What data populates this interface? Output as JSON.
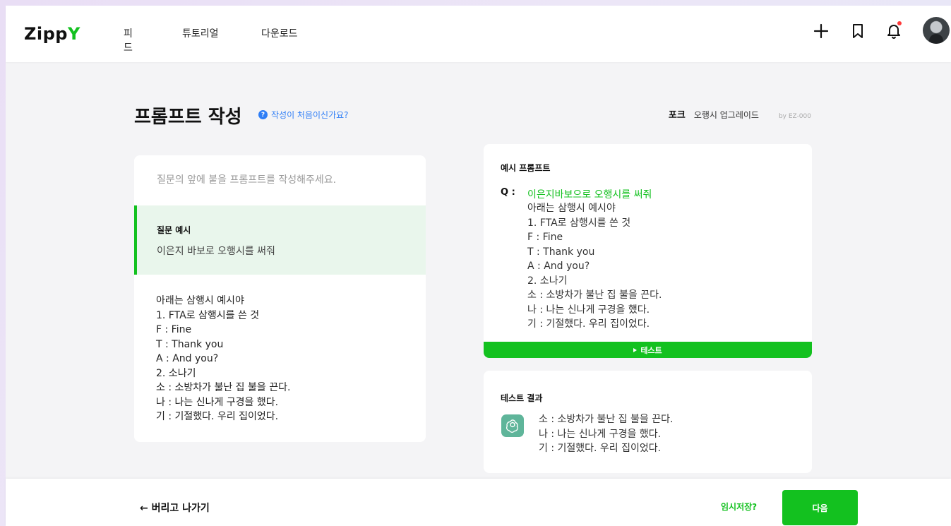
{
  "header": {
    "logo_main": "Zipp",
    "logo_accent": "Y",
    "nav": [
      "피드",
      "튜토리얼",
      "다운로드"
    ]
  },
  "title": {
    "text": "프롬프트 작성",
    "help_icon": "?",
    "help_text": "작성이 처음이신가요?",
    "fork": "포크",
    "prompt_name": "오행시 업그레이드",
    "author": "by EZ-000"
  },
  "editor": {
    "placeholder": "질문의 앞에 붙을 프롬프트를 작성해주세요.",
    "example_label": "질문 예시",
    "example_text": "이은지 바보로 오행시를 써줘",
    "body_lines": [
      "아래는 삼행시 예시야",
      "1. FTA로 삼행시를 쓴 것",
      "F : Fine",
      "T : Thank you",
      "A : And you?",
      "2. 소나기",
      "소 : 소방차가 불난 집 불을 끈다.",
      "나 : 나는 신나게 구경을 했다.",
      "기 : 기절했다. 우리 집이었다."
    ]
  },
  "example_prompt": {
    "title": "예시 프롬프트",
    "q_label": "Q :",
    "question": "이은지바보으로 오행시를 써줘",
    "body_lines": [
      "아래는 삼행시 예시야",
      "1. FTA로 삼행시를 쓴 것",
      "F : Fine",
      "T : Thank you",
      "A : And you?",
      "2. 소나기",
      "소 : 소방차가 불난 집 불을 끈다.",
      "나 : 나는 신나게 구경을 했다.",
      "기 : 기절했다. 우리 집이었다."
    ],
    "test_label": "테스트"
  },
  "result": {
    "title": "테스트 결과",
    "lines": [
      "소 : 소방차가 불난 집 불을 끈다.",
      "나 : 나는 신나게 구경을 했다.",
      "기 : 기절했다. 우리 집이었다."
    ],
    "icon": "chatgpt-icon"
  },
  "footer": {
    "exit_label": "← 버리고 나가기",
    "save_label": "임시저장?",
    "next_label": "다음"
  },
  "colors": {
    "accent": "#13c11f",
    "link": "#2f7ef6",
    "notification": "#ff3a3a"
  }
}
